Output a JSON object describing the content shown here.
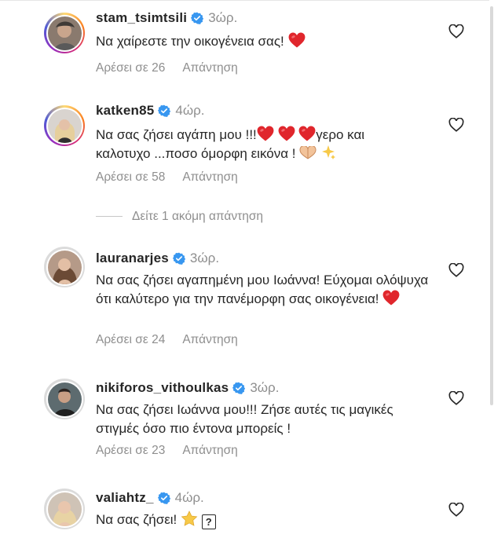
{
  "comments": [
    {
      "username": "stam_tsimtsili",
      "time": "3ώρ.",
      "text": "Να χαίρεστε την οικογένεια σας!",
      "emojis": [
        "red-heart"
      ],
      "likes": "Αρέσει σε 26",
      "reply": "Απάντηση"
    },
    {
      "username": "katken85",
      "time": "4ώρ.",
      "text_line1": "Να σας ζήσει αγάπη μου !!!",
      "text_line1_tail": "γερο και",
      "text_line2": "καλοτυχο ...ποσο όμορφη εικόνα !",
      "emojis": [
        "red-heart",
        "red-heart",
        "red-heart",
        "heart-hands",
        "sparkles"
      ],
      "likes": "Αρέσει σε 58",
      "reply": "Απάντηση"
    },
    {
      "username": "lauranarjes",
      "time": "3ώρ.",
      "text": "Να σας ζήσει αγαπημένη μου Ιωάννα! Εύχομαι ολόψυχα ότι καλύτερο για την πανέμορφη σας οικογένεια!",
      "emojis": [
        "red-heart"
      ],
      "likes": "Αρέσει σε 24",
      "reply": "Απάντηση"
    },
    {
      "username": "nikiforos_vithoulkas",
      "time": "3ώρ.",
      "text": "Να σας ζήσει Ιωάννα μου!!! Ζήσε αυτές τις μαγικές στιγμές όσο πιο έντονα μπορείς !",
      "emojis": [],
      "likes": "Αρέσει σε 23",
      "reply": "Απάντηση"
    },
    {
      "username": "valiahtz_",
      "time": "4ώρ.",
      "text": "Να σας ζήσει!",
      "emojis": [
        "star",
        "unknown-glyph"
      ]
    }
  ],
  "more_replies": "Δείτε 1 ακόμη απάντηση",
  "unknown_glyph": "?",
  "colors": {
    "red_heart": "#e0262c",
    "verified": "#3897f0",
    "muted": "#8e8e8e"
  }
}
